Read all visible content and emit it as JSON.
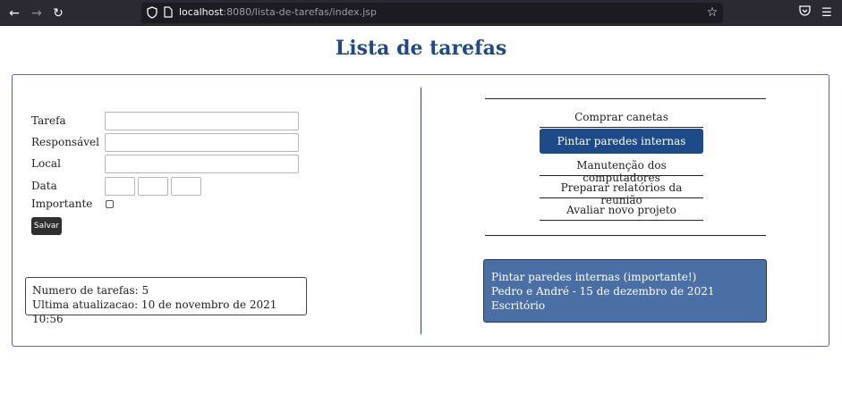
{
  "browser": {
    "url_host": "localhost",
    "url_rest": ":8080/lista-de-tarefas/index.jsp",
    "icons": {
      "back": "arrow-left-icon",
      "forward": "arrow-right-icon",
      "reload": "reload-icon",
      "tracking": "shield-icon",
      "page": "page-icon",
      "bookmark": "star-icon",
      "pocket": "pocket-icon",
      "menu": "hamburger-menu-icon"
    }
  },
  "page": {
    "title": "Lista de tarefas"
  },
  "form": {
    "task_label": "Tarefa",
    "task_value": "",
    "responsible_label": "Responsável",
    "responsible_value": "",
    "location_label": "Local",
    "location_value": "",
    "date_label": "Data",
    "date_day": "",
    "date_month": "",
    "date_year": "",
    "important_label": "Importante",
    "important_checked": false,
    "save_label": "Salvar"
  },
  "stats": {
    "count_line": "Numero de tarefas: 5",
    "updated_line": "Ultima atualizacao: 10 de novembro de 2021 10:56"
  },
  "tasks": [
    {
      "label": "Comprar canetas",
      "selected": false
    },
    {
      "label": "Pintar paredes internas",
      "selected": true
    },
    {
      "label": "Manutenção dos computadores",
      "selected": false
    },
    {
      "label": "Preparar relatórios da reunião",
      "selected": false
    },
    {
      "label": "Avaliar novo projeto",
      "selected": false
    }
  ],
  "detail": {
    "line1": "Pintar paredes internas (importante!)",
    "line2": "Pedro e André - 15 de dezembro de 2021",
    "line3": "Escritório"
  },
  "colors": {
    "accent": "#1e4a87",
    "detail_bg": "#4a6fa5",
    "chrome_bg": "#2b2a33"
  }
}
